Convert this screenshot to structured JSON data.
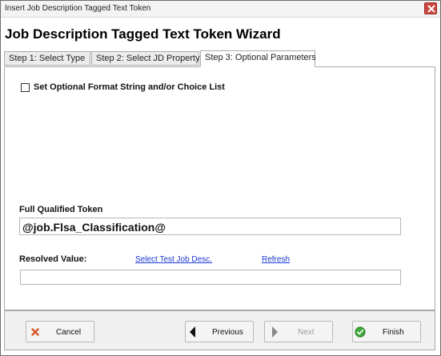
{
  "window": {
    "title": "Insert Job Description Tagged Text Token",
    "close_icon": "close-icon",
    "close_color": "#c9463d"
  },
  "wizard": {
    "title": "Job Description Tagged Text Token Wizard"
  },
  "tabs": [
    {
      "label": "Step 1: Select Type",
      "active": false
    },
    {
      "label": "Step 2: Select JD Property",
      "active": false
    },
    {
      "label": "Step 3: Optional Parameters",
      "active": true
    }
  ],
  "optional": {
    "checkbox_label": "Set Optional Format String and/or Choice List",
    "checked": false
  },
  "token": {
    "label": "Full Qualified Token",
    "value": "@job.Flsa_Classification@"
  },
  "resolved": {
    "label": "Resolved Value:",
    "select_link": "Select Test Job Desc.",
    "refresh_link": "Refresh",
    "value": ""
  },
  "buttons": {
    "cancel": {
      "label": "Cancel",
      "icon": "x-icon",
      "enabled": true
    },
    "previous": {
      "label": "Previous",
      "icon": "arrow-left-icon",
      "enabled": true
    },
    "next": {
      "label": "Next",
      "icon": "arrow-right-icon",
      "enabled": false
    },
    "finish": {
      "label": "Finish",
      "icon": "check-circle-icon",
      "enabled": true
    }
  },
  "colors": {
    "link": "#1a36d8",
    "cancel_icon": "#d9572a",
    "finish_icon": "#3fa63a"
  }
}
